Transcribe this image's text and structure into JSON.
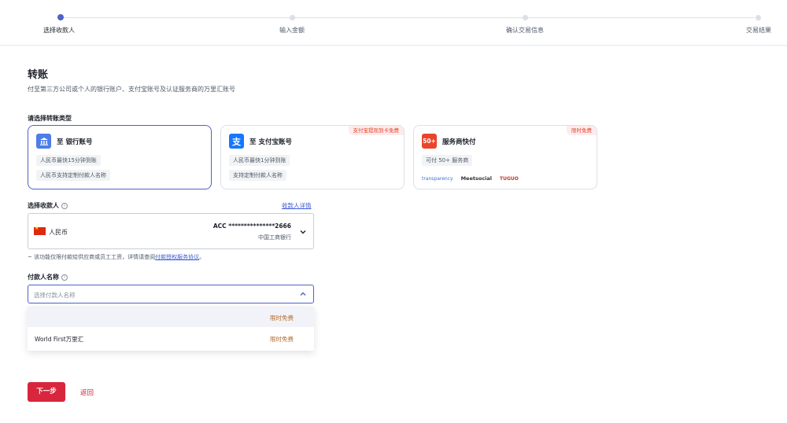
{
  "steps": [
    {
      "label": "选择收款人"
    },
    {
      "label": "输入金额"
    },
    {
      "label": "确认交易信息"
    },
    {
      "label": "交易结果"
    }
  ],
  "page": {
    "title": "转账",
    "subtitle": "付至第三方公司或个人的银行账户、支付宝账号及认证服务商的万里汇账号",
    "type_label": "请选择转账类型"
  },
  "cards": [
    {
      "icon": "bank-icon",
      "title": "至 银行账号",
      "chips": [
        "人民币最快15分钟到账",
        "人民币支持定制付款人名称"
      ],
      "selected": true
    },
    {
      "icon": "alipay-icon",
      "title": "至 支付宝账号",
      "badge": "支付宝提现到卡免费",
      "chips": [
        "人民币最快1分钟到账",
        "支持定制付款人名称"
      ]
    },
    {
      "icon": "provider-icon",
      "icon_text": "50+",
      "title": "服务商快付",
      "badge": "限时免费",
      "chips": [
        "可付 50+ 服务商"
      ],
      "logos": [
        "transparency",
        "Meetsocial",
        "TUGUO"
      ]
    }
  ],
  "payee": {
    "label": "选择收款人",
    "details_link": "收款人详情",
    "currency": "人民币",
    "account": "ACC ***************2666",
    "bank": "中国工商银行"
  },
  "note": {
    "text": "~ 该功能仅限付款给供应商或员工工资，详情请查阅",
    "link": "付款授权服务协议",
    "suffix": "。"
  },
  "payer": {
    "label": "付款人名称",
    "placeholder": "选择付款人名称",
    "options": [
      {
        "name": "",
        "tag": "限时免费"
      },
      {
        "name": "World First万里汇",
        "tag": "限时免费"
      }
    ]
  },
  "actions": {
    "next": "下一步",
    "back": "返回"
  },
  "colors": {
    "accent": "#4d63c8",
    "primary_button": "#d7263d",
    "badge_text": "#e6442d",
    "free_tag": "#b26a2e"
  }
}
